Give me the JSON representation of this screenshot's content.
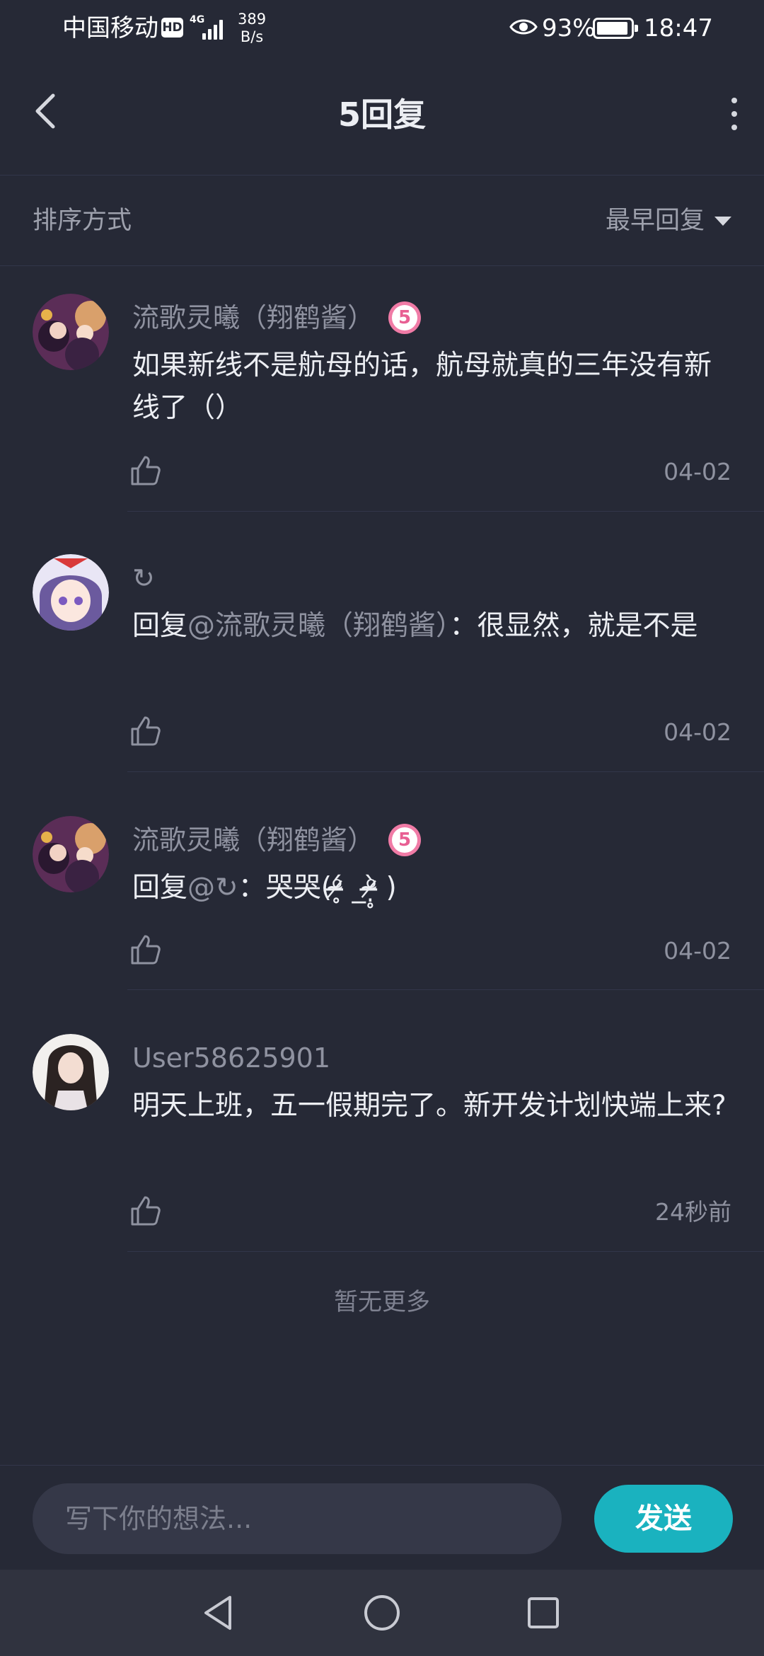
{
  "status_bar": {
    "carrier": "中国移动",
    "hd_label": "HD",
    "network": "4G",
    "speed_value": "389",
    "speed_unit": "B/s",
    "battery_percent": "93%",
    "battery_level": 0.93,
    "time": "18:47"
  },
  "header": {
    "title": "5回复"
  },
  "sort": {
    "label": "排序方式",
    "selected": "最早回复"
  },
  "comments": [
    {
      "username": "流歌灵曦（翔鹤酱）",
      "level": "5",
      "text": "如果新线不是航母的话，航母就真的三年没有新线了（）",
      "time": "04-02"
    },
    {
      "username": "↻",
      "reply_prefix": "回复",
      "reply_to": "@流歌灵曦（翔鹤酱）",
      "text": "：很显然，就是不是",
      "time": "04-02"
    },
    {
      "username": "流歌灵曦（翔鹤酱）",
      "level": "5",
      "reply_prefix": "回复",
      "reply_to": "@↻",
      "text": "：哭哭(ᵒ̴̶̷̥́ _ᵒ̴̶̷̣̥̀ )",
      "time": "04-02"
    },
    {
      "username": "User58625901",
      "text": "明天上班，五一假期完了。新开发计划快端上来?",
      "time": "24秒前"
    }
  ],
  "footer_note": "暂无更多",
  "input": {
    "placeholder": "写下你的想法...",
    "send_label": "发送"
  },
  "colors": {
    "background": "#262936",
    "accent": "#1ab2bf",
    "level_badge": "#f07ba6"
  }
}
